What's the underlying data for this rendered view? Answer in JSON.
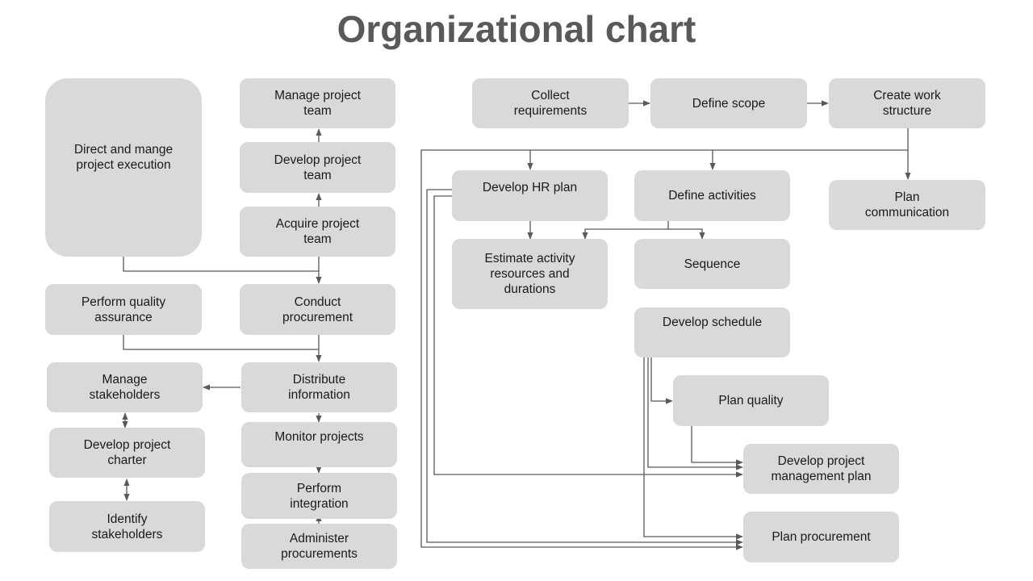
{
  "title": "Organizational chart",
  "nodes": {
    "direct_manage": "Direct and mange\nproject execution",
    "manage_team": "Manage project\nteam",
    "develop_team": "Develop project\nteam",
    "acquire_team": "Acquire project\nteam",
    "perform_qa": "Perform quality\nassurance",
    "conduct_procurement": "Conduct\nprocurement",
    "manage_stakeholders": "Manage\nstakeholders",
    "distribute_info": "Distribute\ninformation",
    "develop_charter": "Develop project\ncharter",
    "monitor_projects": "Monitor projects",
    "perform_integration": "Perform\nintegration",
    "identify_stakeholders": "Identify\nstakeholders",
    "administer_procurements": "Administer\nprocurements",
    "collect_requirements": "Collect\nrequirements",
    "define_scope": "Define scope",
    "create_work_structure": "Create work\nstructure",
    "develop_hr_plan": "Develop HR plan",
    "define_activities": "Define activities",
    "plan_communication": "Plan\ncommunication",
    "estimate_activity": "Estimate activity\nresources and\ndurations",
    "sequence": "Sequence",
    "develop_schedule": "Develop schedule",
    "plan_quality": "Plan quality",
    "develop_pm_plan": "Develop project\nmanagement plan",
    "plan_procurement": "Plan procurement"
  },
  "colors": {
    "node_fill": "#d9d9d9",
    "connector": "#595959",
    "title": "#595959"
  }
}
